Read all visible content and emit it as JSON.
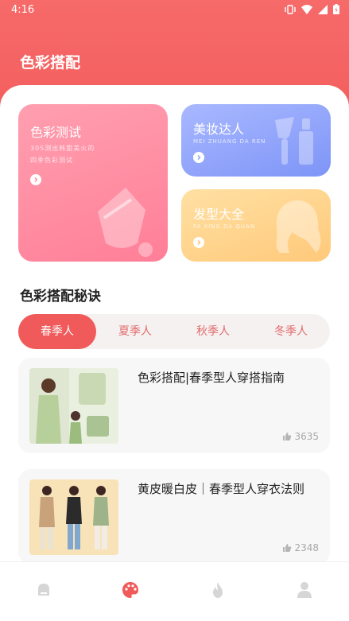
{
  "status": {
    "time": "4:16"
  },
  "app": {
    "title": "色彩搭配"
  },
  "cards": {
    "color_test": {
      "title": "色彩测试",
      "sub1": "30S测出韩甜美火的",
      "sub2": "四季色彩测试"
    },
    "makeup": {
      "title": "美妆达人",
      "sub": "MEI ZHUANG DA REN"
    },
    "hair": {
      "title": "发型大全",
      "sub": "FA XING DA QUAN"
    }
  },
  "section": {
    "title": "色彩搭配秘诀"
  },
  "tabs": [
    "春季人",
    "夏季人",
    "秋季人",
    "冬季人"
  ],
  "articles": [
    {
      "title": "色彩搭配|春季型人穿搭指南",
      "likes": "3635"
    },
    {
      "title": "黄皮暖白皮｜春季型人穿衣法则",
      "likes": "2348"
    }
  ],
  "colors": {
    "accent": "#f05a5a",
    "header": "#f66a6a"
  },
  "nav": [
    "home-icon",
    "palette-icon",
    "fire-icon",
    "profile-icon"
  ]
}
